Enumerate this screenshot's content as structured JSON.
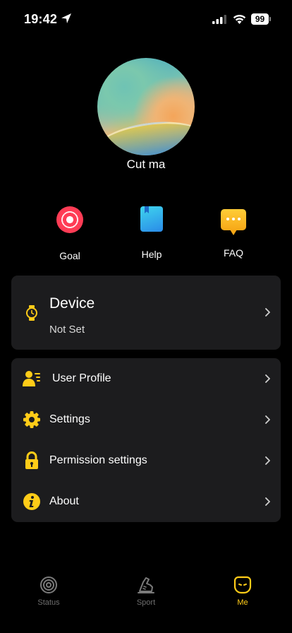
{
  "status_bar": {
    "time": "19:42",
    "battery": "99"
  },
  "profile": {
    "name": "Cut ma"
  },
  "quick_actions": [
    {
      "label": "Goal",
      "icon": "goal-target-icon"
    },
    {
      "label": "Help",
      "icon": "help-book-icon"
    },
    {
      "label": "FAQ",
      "icon": "faq-chat-icon"
    }
  ],
  "device": {
    "title": "Device",
    "status": "Not Set",
    "icon": "watch-icon"
  },
  "menu": [
    {
      "label": "User Profile",
      "icon": "user-profile-icon"
    },
    {
      "label": "Settings",
      "icon": "gear-icon"
    },
    {
      "label": "Permission settings",
      "icon": "lock-icon"
    },
    {
      "label": "About",
      "icon": "info-icon"
    }
  ],
  "tabs": [
    {
      "label": "Status",
      "icon": "status-rings-icon"
    },
    {
      "label": "Sport",
      "icon": "sport-shoe-icon"
    },
    {
      "label": "Me",
      "icon": "me-face-icon"
    }
  ],
  "colors": {
    "accent": "#ffcc18",
    "card": "#1c1c1e",
    "background": "#000000"
  }
}
